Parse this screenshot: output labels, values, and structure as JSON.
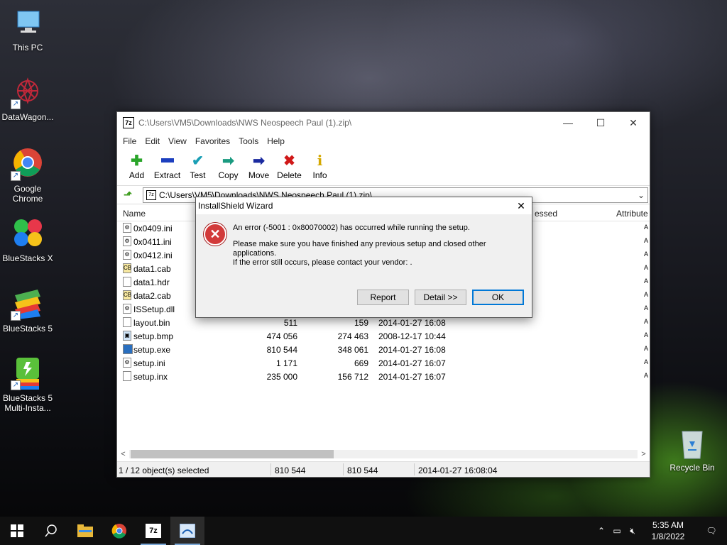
{
  "desktop": {
    "icons": [
      {
        "label": "This PC",
        "icon": "computer-icon"
      },
      {
        "label": "DataWagon...",
        "icon": "datawagon-icon"
      },
      {
        "label": "Google Chrome",
        "icon": "chrome-icon"
      },
      {
        "label": "BlueStacks X",
        "icon": "bluestacks-x-icon"
      },
      {
        "label": "BlueStacks 5",
        "icon": "bluestacks-5-icon"
      },
      {
        "label": "BlueStacks 5 Multi-Insta...",
        "icon": "bluestacks-multi-icon"
      },
      {
        "label": "Recycle Bin",
        "icon": "recycle-bin-icon"
      }
    ]
  },
  "window": {
    "title": "C:\\Users\\VM5\\Downloads\\NWS Neospeech Paul (1).zip\\",
    "app_icon": "7z",
    "menu": [
      "File",
      "Edit",
      "View",
      "Favorites",
      "Tools",
      "Help"
    ],
    "toolbar": [
      {
        "label": "Add",
        "icon": "plus-icon",
        "color": "#2aa52a"
      },
      {
        "label": "Extract",
        "icon": "minus-icon",
        "color": "#1c3fbf"
      },
      {
        "label": "Test",
        "icon": "check-icon",
        "color": "#1a9fb5"
      },
      {
        "label": "Copy",
        "icon": "copy-arrow-icon",
        "color": "#1a9a80"
      },
      {
        "label": "Move",
        "icon": "move-arrow-icon",
        "color": "#1a2a9f"
      },
      {
        "label": "Delete",
        "icon": "delete-x-icon",
        "color": "#d01818"
      },
      {
        "label": "Info",
        "icon": "info-icon",
        "color": "#d4a800"
      }
    ],
    "address": "C:\\Users\\VM5\\Downloads\\NWS Neospeech Paul (1).zip\\",
    "columns": {
      "name": "Name",
      "packed_partial": "essed",
      "attributes": "Attribute"
    },
    "files": [
      {
        "name": "0x0409.ini",
        "size": "",
        "packed": "",
        "modified": "",
        "attr": "A"
      },
      {
        "name": "0x0411.ini",
        "size": "",
        "packed": "",
        "modified": "",
        "attr": "A"
      },
      {
        "name": "0x0412.ini",
        "size": "",
        "packed": "",
        "modified": "",
        "attr": "A"
      },
      {
        "name": "data1.cab",
        "size": "",
        "packed": "",
        "modified": "",
        "attr": "A"
      },
      {
        "name": "data1.hdr",
        "size": "",
        "packed": "",
        "modified": "",
        "attr": "A"
      },
      {
        "name": "data2.cab",
        "size": "",
        "packed": "",
        "modified": "",
        "attr": "A"
      },
      {
        "name": "ISSetup.dll",
        "size": "",
        "packed": "",
        "modified": "",
        "attr": "A"
      },
      {
        "name": "layout.bin",
        "size": "511",
        "packed": "159",
        "modified": "2014-01-27 16:08",
        "attr": "A"
      },
      {
        "name": "setup.bmp",
        "size": "474 056",
        "packed": "274 463",
        "modified": "2008-12-17 10:44",
        "attr": "A"
      },
      {
        "name": "setup.exe",
        "size": "810 544",
        "packed": "348 061",
        "modified": "2014-01-27 16:08",
        "attr": "A"
      },
      {
        "name": "setup.ini",
        "size": "1 171",
        "packed": "669",
        "modified": "2014-01-27 16:07",
        "attr": "A"
      },
      {
        "name": "setup.inx",
        "size": "235 000",
        "packed": "156 712",
        "modified": "2014-01-27 16:07",
        "attr": "A"
      }
    ],
    "status": {
      "selection": "1 / 12 object(s) selected",
      "size": "810 544",
      "packed": "810 544",
      "modified": "2014-01-27 16:08:04"
    }
  },
  "dialog": {
    "title": "InstallShield Wizard",
    "message1": "An error (-5001 : 0x80070002) has occurred while running the setup.",
    "message2": "Please make sure you have finished any previous setup and closed other applications.",
    "message3": "If the error still occurs, please contact your vendor: .",
    "buttons": {
      "report": "Report",
      "detail": "Detail >>",
      "ok": "OK"
    }
  },
  "taskbar": {
    "time": "5:35 AM",
    "date": "1/8/2022",
    "apps": [
      "start-icon",
      "search-icon",
      "file-explorer-icon",
      "chrome-icon",
      "7zip-icon",
      "installshield-icon"
    ]
  }
}
